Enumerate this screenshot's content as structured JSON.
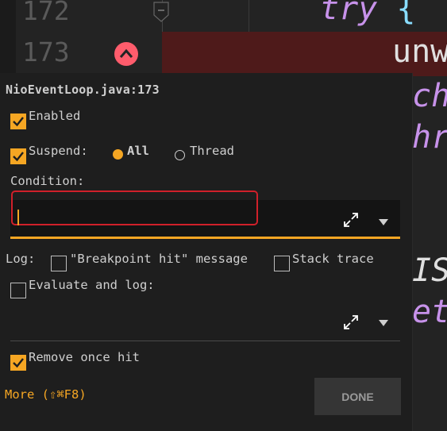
{
  "editor": {
    "line_numbers": [
      "172",
      "173"
    ],
    "code_line_172": "try",
    "code_brace": "{",
    "code_line_173": "unw",
    "right_fragments": [
      "ch",
      "hr",
      "IS",
      "et"
    ]
  },
  "popup": {
    "title": "NioEventLoop.java:173",
    "enabled": {
      "label": "Enabled",
      "checked": true
    },
    "suspend": {
      "label": "Suspend:",
      "checked": true
    },
    "suspend_options": {
      "all": "All",
      "thread": "Thread",
      "selected": "All"
    },
    "condition": {
      "label": "Condition:",
      "value": ""
    },
    "log": {
      "label": "Log:",
      "message_label": "\"Breakpoint hit\" message",
      "message_checked": false,
      "stack_label": "Stack trace",
      "stack_checked": false
    },
    "evaluate": {
      "label": "Evaluate and log:",
      "checked": false,
      "value": ""
    },
    "remove_once_hit": {
      "label": "Remove once hit",
      "checked": true
    },
    "more_link": "More (⇧⌘F8)",
    "done_label": "DONE"
  },
  "colors": {
    "accent": "#f5a623",
    "breakpoint": "#ff5c6c",
    "focus_border": "#d0202a",
    "keyword": "#c792ea"
  }
}
